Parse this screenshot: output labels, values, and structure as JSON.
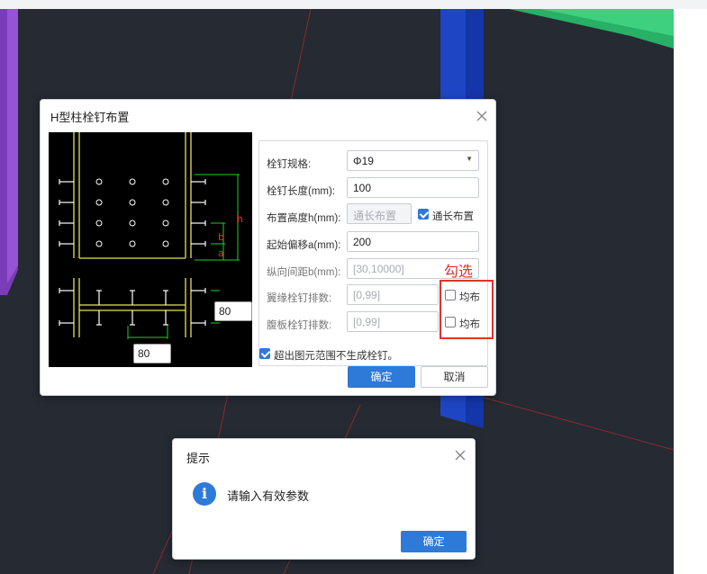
{
  "main_dialog": {
    "title": "H型柱栓钉布置",
    "preview": {
      "dim_h": "h",
      "dim_b": "b",
      "dim_a": "a",
      "input_right": "80",
      "input_bottom": "80"
    },
    "fields": {
      "spec_label": "栓钉规格:",
      "spec_value": "Φ19",
      "length_label": "栓钉长度(mm):",
      "length_value": "100",
      "height_label": "布置高度h(mm):",
      "height_placeholder": "通长布置",
      "full_length_label": "通长布置",
      "full_length_checked": true,
      "offset_label": "起始偏移a(mm):",
      "offset_value": "200",
      "spacing_label": "纵向间距b(mm):",
      "spacing_placeholder": "[30,10000]",
      "flange_rows_label": "翼缘栓钉排数:",
      "flange_rows_placeholder": "[0,99]",
      "flange_even_label": "均布",
      "flange_even_checked": false,
      "web_rows_label": "腹板栓钉排数:",
      "web_rows_placeholder": "[0,99]",
      "web_even_label": "均布",
      "web_even_checked": false
    },
    "skip_out_of_range_label": "超出图元范围不生成栓钉。",
    "skip_out_of_range_checked": true,
    "ok_label": "确定",
    "cancel_label": "取消"
  },
  "annotation": {
    "text": "勾选",
    "color": "#e0322a"
  },
  "tip_dialog": {
    "title": "提示",
    "icon": "info-icon",
    "message": "请输入有效参数",
    "ok_label": "确定"
  },
  "colors": {
    "accent": "#2d7ad8",
    "viewport_bg": "#252a33",
    "drawing_line": "#e6e25a",
    "dimension_line": "#22d022"
  }
}
